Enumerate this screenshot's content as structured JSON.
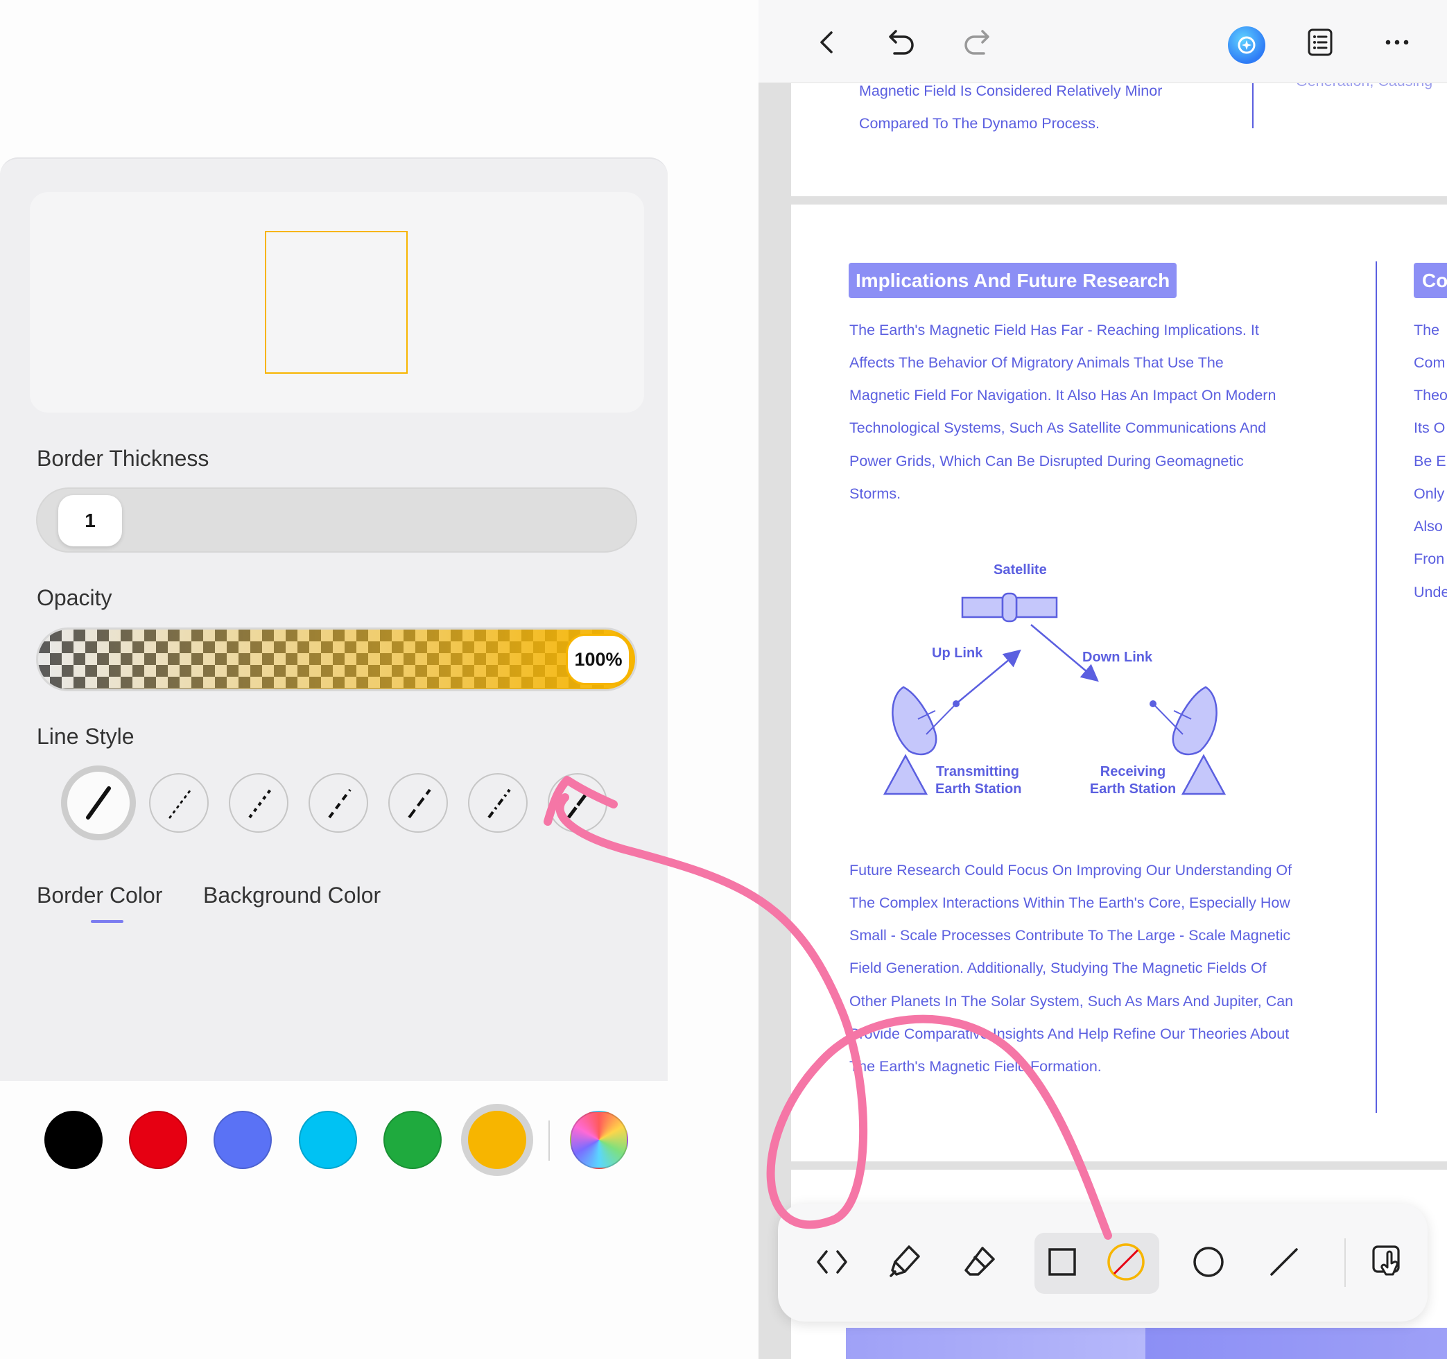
{
  "panel": {
    "border_thickness_label": "Border Thickness",
    "border_thickness_value": "1",
    "opacity_label": "Opacity",
    "opacity_value": "100%",
    "opacity_fraction": 1.0,
    "line_style_label": "Line Style",
    "line_styles": [
      "solid",
      "dotted",
      "short-dash",
      "dash",
      "long-dash",
      "dash-dot",
      "none"
    ],
    "selected_line_style": "solid",
    "tabs": [
      "Border Color",
      "Background Color"
    ],
    "active_tab": "Border Color",
    "swatches": [
      "#000000",
      "#e60012",
      "#5a72f5",
      "#00c2f3",
      "#1faa3e",
      "#f7b500"
    ],
    "selected_swatch": "#f7b500",
    "custom_color_icon": "color-wheel-icon"
  },
  "topbar": {
    "icons": [
      "back-icon",
      "undo-icon",
      "redo-icon",
      "ai-assistant-icon",
      "outline-icon",
      "more-icon"
    ]
  },
  "document": {
    "prev_page_lines": [
      "Magnetic Field Is Considered Relatively Minor",
      "Compared To The Dynamo Process."
    ],
    "prev_page_right_fragment": "Generation, Causing",
    "heading": "Implications And Future Research",
    "para1": [
      "The Earth's Magnetic Field Has Far - Reaching Implications. It",
      "Affects The Behavior Of Migratory Animals That Use The",
      "Magnetic Field For Navigation. It Also Has An Impact On Modern",
      "Technological Systems, Such As Satellite Communications And",
      "Power Grids, Which Can Be Disrupted During Geomagnetic",
      "Storms."
    ],
    "diagram": {
      "satellite": "Satellite",
      "uplink": "Up Link",
      "downlink": "Down Link",
      "transmitting_1": "Transmitting",
      "transmitting_2": "Earth Station",
      "receiving_1": "Receiving",
      "receiving_2": "Earth Station"
    },
    "para2": [
      "Future Research Could Focus On Improving Our Understanding Of",
      "The Complex Interactions Within The Earth's Core, Especially How",
      "Small - Scale Processes Contribute To The Large - Scale Magnetic",
      "Field Generation. Additionally, Studying The Magnetic Fields Of",
      "Other Planets In The Solar System, Such As Mars And Jupiter, Can",
      "Provide Comparative Insights And Help Refine Our Theories About",
      "The Earth's Magnetic Field Formation."
    ],
    "right_heading_fragment": "Co",
    "right_col_fragments": [
      "The",
      "Com",
      "Theo",
      "Its O",
      "Be E",
      "Only",
      "Also",
      "Fron",
      "Unde"
    ]
  },
  "toolbar": {
    "tools": [
      "collapse-toolbar-icon",
      "highlighter-icon",
      "eraser-icon",
      "rectangle-icon",
      "shape-style-icon",
      "circle-icon",
      "line-icon",
      "touch-mode-icon"
    ],
    "active_tool": "rectangle-icon"
  },
  "colors": {
    "accent": "#5b5fe0",
    "heading_bg": "#8c8ff5",
    "annotation_pink": "#f576a6",
    "shape_border": "#f7b500"
  }
}
